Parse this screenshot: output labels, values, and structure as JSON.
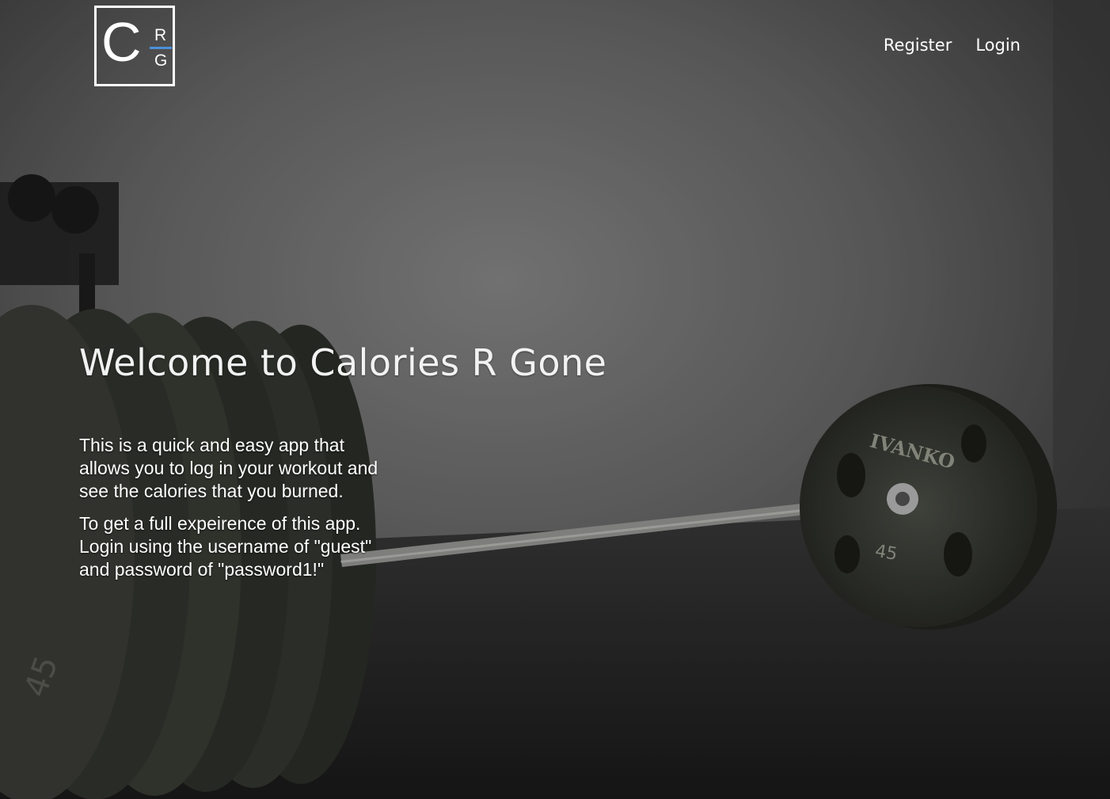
{
  "logo": {
    "letter_c": "C",
    "letter_r": "R",
    "letter_g": "G",
    "accent_color": "#4a90d9"
  },
  "nav": {
    "register_label": "Register",
    "login_label": "Login"
  },
  "hero": {
    "title": "Welcome to Calories R Gone",
    "paragraph_1": "This is a quick and easy app that allows you to log in your workout and see the calories that you burned.",
    "paragraph_2": "To get a full expeirence of this app. Login using the username of \"guest\" and password of \"password1!\""
  },
  "background": {
    "plate_brand": "IVANKO",
    "plate_weight_right": "45",
    "plate_weight_left": "45"
  }
}
